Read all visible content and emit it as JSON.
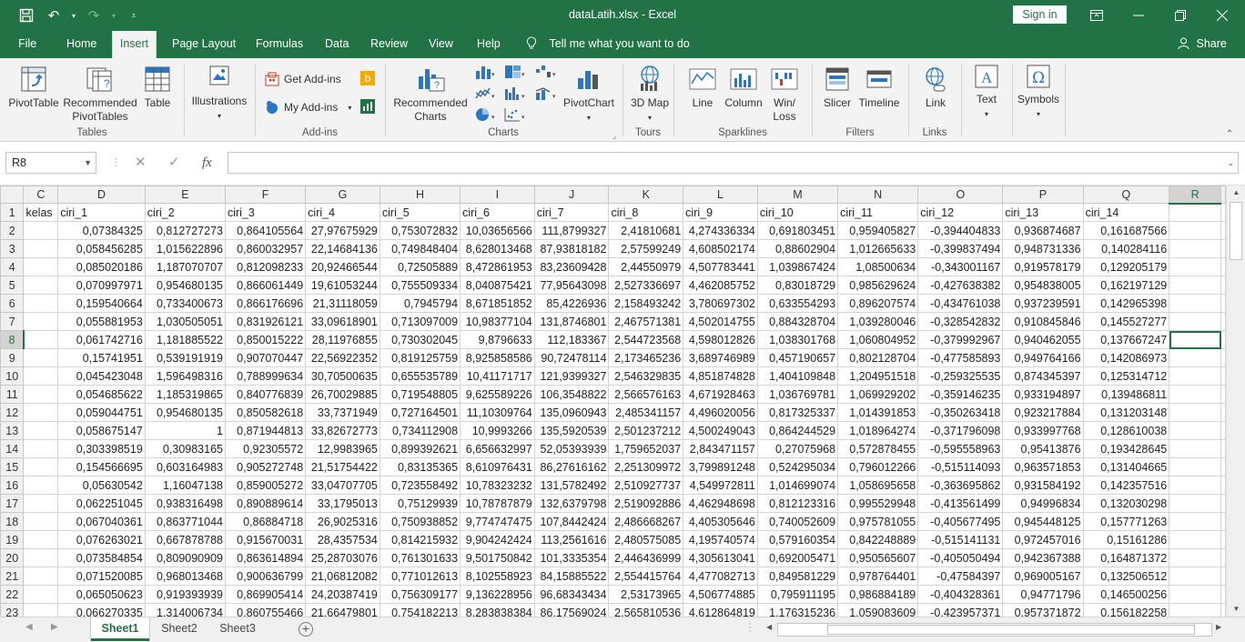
{
  "titlebar": {
    "title": "dataLatih.xlsx  -  Excel",
    "signin": "Sign in"
  },
  "tabs": [
    "File",
    "Home",
    "Insert",
    "Page Layout",
    "Formulas",
    "Data",
    "Review",
    "View",
    "Help"
  ],
  "tell_me": "Tell me what you want to do",
  "share": "Share",
  "ribbon": {
    "pivottable": "PivotTable",
    "recommended_pivot": "Recommended PivotTables",
    "table": "Table",
    "illustrations": "Illustrations",
    "get_addins": "Get Add-ins",
    "my_addins": "My Add-ins",
    "recommended_charts": "Recommended Charts",
    "pivotchart": "PivotChart",
    "map3d": "3D Map",
    "line": "Line",
    "column": "Column",
    "winloss": "Win/ Loss",
    "slicer": "Slicer",
    "timeline": "Timeline",
    "link": "Link",
    "text": "Text",
    "symbols": "Symbols",
    "groups": {
      "tables": "Tables",
      "addins": "Add-ins",
      "charts": "Charts",
      "tours": "Tours",
      "sparklines": "Sparklines",
      "filters": "Filters",
      "links": "Links"
    }
  },
  "formula_bar": {
    "name_box": "R8",
    "fx": "fx",
    "formula": ""
  },
  "grid": {
    "columns": [
      "C",
      "D",
      "E",
      "F",
      "G",
      "H",
      "I",
      "J",
      "K",
      "L",
      "M",
      "N",
      "O",
      "P",
      "Q",
      "R"
    ],
    "rows": [
      {
        "n": "1",
        "cells": [
          "kelas",
          "ciri_1",
          "ciri_2",
          "ciri_3",
          "ciri_4",
          "ciri_5",
          "ciri_6",
          "ciri_7",
          "ciri_8",
          "ciri_9",
          "ciri_10",
          "ciri_11",
          "ciri_12",
          "ciri_13",
          "ciri_14",
          ""
        ]
      },
      {
        "n": "2",
        "cells": [
          "",
          "0,07384325",
          "0,812727273",
          "0,864105564",
          "27,97675929",
          "0,753072832",
          "10,03656566",
          "111,8799327",
          "2,41810681",
          "4,274336334",
          "0,691803451",
          "0,959405827",
          "-0,394404833",
          "0,936874687",
          "0,161687566",
          ""
        ]
      },
      {
        "n": "3",
        "cells": [
          "",
          "0,058456285",
          "1,015622896",
          "0,860032957",
          "22,14684136",
          "0,749848404",
          "8,628013468",
          "87,93818182",
          "2,57599249",
          "4,608502174",
          "0,88602904",
          "1,012665633",
          "-0,399837494",
          "0,948731336",
          "0,140284116",
          ""
        ]
      },
      {
        "n": "4",
        "cells": [
          "",
          "0,085020186",
          "1,187070707",
          "0,812098233",
          "20,92466544",
          "0,72505889",
          "8,472861953",
          "83,23609428",
          "2,44550979",
          "4,507783441",
          "1,039867424",
          "1,08500634",
          "-0,343001167",
          "0,919578179",
          "0,129205179",
          ""
        ]
      },
      {
        "n": "5",
        "cells": [
          "",
          "0,070997971",
          "0,954680135",
          "0,866061449",
          "19,61053244",
          "0,755509334",
          "8,040875421",
          "77,95643098",
          "2,527336697",
          "4,462085752",
          "0,83018729",
          "0,985629624",
          "-0,427638382",
          "0,954838005",
          "0,162197129",
          ""
        ]
      },
      {
        "n": "6",
        "cells": [
          "",
          "0,159540664",
          "0,733400673",
          "0,866176696",
          "21,31118059",
          "0,7945794",
          "8,671851852",
          "85,4226936",
          "2,158493242",
          "3,780697302",
          "0,633554293",
          "0,896207574",
          "-0,434761038",
          "0,937239591",
          "0,142965398",
          ""
        ]
      },
      {
        "n": "7",
        "cells": [
          "",
          "0,055881953",
          "1,030505051",
          "0,831926121",
          "33,09618901",
          "0,713097009",
          "10,98377104",
          "131,8746801",
          "2,467571381",
          "4,502014755",
          "0,884328704",
          "1,039280046",
          "-0,328542832",
          "0,910845846",
          "0,145527277",
          ""
        ]
      },
      {
        "n": "8",
        "cells": [
          "",
          "0,061742716",
          "1,181885522",
          "0,850015222",
          "28,11976855",
          "0,730302045",
          "9,8796633",
          "112,183367",
          "2,544723568",
          "4,598012826",
          "1,038301768",
          "1,060804952",
          "-0,379992967",
          "0,940462055",
          "0,137667247",
          ""
        ]
      },
      {
        "n": "9",
        "cells": [
          "",
          "0,15741951",
          "0,539191919",
          "0,907070447",
          "22,56922352",
          "0,819125759",
          "8,925858586",
          "90,72478114",
          "2,173465236",
          "3,689746989",
          "0,457190657",
          "0,802128704",
          "-0,477585893",
          "0,949764166",
          "0,142086973",
          ""
        ]
      },
      {
        "n": "10",
        "cells": [
          "",
          "0,045423048",
          "1,596498316",
          "0,788999634",
          "30,70500635",
          "0,655535789",
          "10,41171717",
          "121,9399327",
          "2,546329835",
          "4,851874828",
          "1,404109848",
          "1,204951518",
          "-0,259325535",
          "0,874345397",
          "0,125314712",
          ""
        ]
      },
      {
        "n": "11",
        "cells": [
          "",
          "0,054685622",
          "1,185319865",
          "0,840776839",
          "26,70029885",
          "0,719548805",
          "9,625589226",
          "106,3548822",
          "2,566576163",
          "4,671928463",
          "1,036769781",
          "1,069929202",
          "-0,359146235",
          "0,933194897",
          "0,139486811",
          ""
        ]
      },
      {
        "n": "12",
        "cells": [
          "",
          "0,059044751",
          "0,954680135",
          "0,850582618",
          "33,7371949",
          "0,727164501",
          "11,10309764",
          "135,0960943",
          "2,485341157",
          "4,496020056",
          "0,817325337",
          "1,014391853",
          "-0,350263418",
          "0,923217884",
          "0,131203148",
          ""
        ]
      },
      {
        "n": "13",
        "cells": [
          "",
          "0,058675147",
          "1",
          "0,871944813",
          "33,82672773",
          "0,734112908",
          "10,9993266",
          "135,5920539",
          "2,501237212",
          "4,500249043",
          "0,864244529",
          "1,018964274",
          "-0,371796098",
          "0,933997768",
          "0,128610038",
          ""
        ]
      },
      {
        "n": "14",
        "cells": [
          "",
          "0,303398519",
          "0,30983165",
          "0,92305572",
          "12,9983965",
          "0,899392621",
          "6,656632997",
          "52,05393939",
          "1,759652037",
          "2,843471157",
          "0,27075968",
          "0,572878455",
          "-0,595558963",
          "0,95413876",
          "0,193428645",
          ""
        ]
      },
      {
        "n": "15",
        "cells": [
          "",
          "0,154566695",
          "0,603164983",
          "0,905272748",
          "21,51754422",
          "0,83135365",
          "8,610976431",
          "86,27616162",
          "2,251309972",
          "3,799891248",
          "0,524295034",
          "0,796012266",
          "-0,515114093",
          "0,963571853",
          "0,131404665",
          ""
        ]
      },
      {
        "n": "16",
        "cells": [
          "",
          "0,05630542",
          "1,16047138",
          "0,859005272",
          "33,04707705",
          "0,723558492",
          "10,78323232",
          "131,5782492",
          "2,510927737",
          "4,549972811",
          "1,014699074",
          "1,058695658",
          "-0,363695862",
          "0,931584192",
          "0,142357516",
          ""
        ]
      },
      {
        "n": "17",
        "cells": [
          "",
          "0,062251045",
          "0,938316498",
          "0,890889614",
          "33,1795013",
          "0,75129939",
          "10,78787879",
          "132,6379798",
          "2,519092886",
          "4,462948698",
          "0,812123316",
          "0,995529948",
          "-0,413561499",
          "0,94996834",
          "0,132030298",
          ""
        ]
      },
      {
        "n": "18",
        "cells": [
          "",
          "0,067040361",
          "0,863771044",
          "0,86884718",
          "26,9025316",
          "0,750938852",
          "9,774747475",
          "107,8442424",
          "2,486668267",
          "4,405305646",
          "0,740052609",
          "0,975781055",
          "-0,405677495",
          "0,945448125",
          "0,157771263",
          ""
        ]
      },
      {
        "n": "19",
        "cells": [
          "",
          "0,076263021",
          "0,667878788",
          "0,915670031",
          "28,4357534",
          "0,814215932",
          "9,904242424",
          "113,2561616",
          "2,480575085",
          "4,195740574",
          "0,579160354",
          "0,842248889",
          "-0,515141131",
          "0,972457016",
          "0,15161286",
          ""
        ]
      },
      {
        "n": "20",
        "cells": [
          "",
          "0,073584854",
          "0,809090909",
          "0,863614894",
          "25,28703076",
          "0,761301633",
          "9,501750842",
          "101,3335354",
          "2,446436999",
          "4,305613041",
          "0,692005471",
          "0,950565607",
          "-0,405050494",
          "0,942367388",
          "0,164871372",
          ""
        ]
      },
      {
        "n": "21",
        "cells": [
          "",
          "0,071520085",
          "0,968013468",
          "0,900636799",
          "21,06812082",
          "0,771012613",
          "8,102558923",
          "84,15885522",
          "2,554415764",
          "4,477082713",
          "0,849581229",
          "0,978764401",
          "-0,47584397",
          "0,969005167",
          "0,132506512",
          ""
        ]
      },
      {
        "n": "22",
        "cells": [
          "",
          "0,065050623",
          "0,919393939",
          "0,869905414",
          "24,20387419",
          "0,756309177",
          "9,136228956",
          "96,68343434",
          "2,53173965",
          "4,506774885",
          "0,795911195",
          "0,986884189",
          "-0,404328361",
          "0,94771796",
          "0,146500256",
          ""
        ]
      },
      {
        "n": "23",
        "cells": [
          "",
          "0,066270335",
          "1,314006734",
          "0,860755466",
          "21,66479801",
          "0,754182213",
          "8,283838384",
          "86,17569024",
          "2,565810536",
          "4,612864819",
          "1,176315236",
          "1,059083609",
          "-0,423957371",
          "0,957371872",
          "0,156182258",
          ""
        ]
      }
    ]
  },
  "sheets": [
    "Sheet1",
    "Sheet2",
    "Sheet3"
  ],
  "active_sheet": "Sheet1",
  "colors": {
    "accent": "#217346",
    "ribbon_bg": "#f3f3f3"
  }
}
